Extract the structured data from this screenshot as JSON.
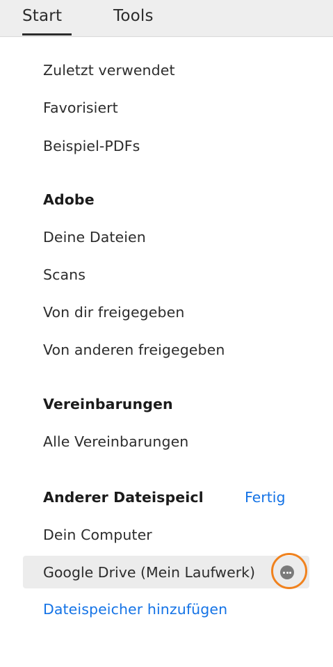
{
  "tabs": {
    "start": "Start",
    "tools": "Tools"
  },
  "recent": {
    "zuletzt": "Zuletzt verwendet",
    "favorisiert": "Favorisiert",
    "beispiel": "Beispiel-PDFs"
  },
  "adobe": {
    "heading": "Adobe",
    "deine_dateien": "Deine Dateien",
    "scans": "Scans",
    "von_dir": "Von dir freigegeben",
    "von_anderen": "Von anderen freigegeben"
  },
  "vereinbarungen": {
    "heading": "Vereinbarungen",
    "alle": "Alle Vereinbarungen"
  },
  "storage": {
    "heading": "Anderer Dateispeicl",
    "fertig": "Fertig",
    "dein_computer": "Dein Computer",
    "google_drive": "Google Drive (Mein Laufwerk)",
    "add": "Dateispeicher hinzufügen"
  },
  "colors": {
    "accent": "#1473e6",
    "highlight": "#f0821e"
  }
}
